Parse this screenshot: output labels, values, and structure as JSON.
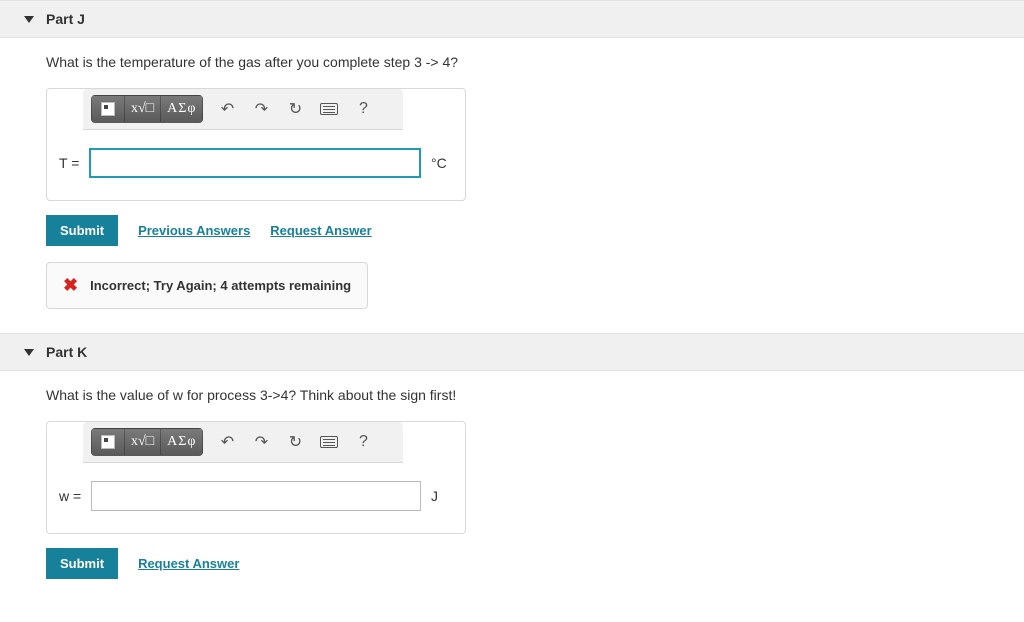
{
  "parts": [
    {
      "id": "J",
      "title": "Part J",
      "question": "What is the temperature of the gas after you complete step 3 -> 4?",
      "var_label": "T =",
      "unit": "°C",
      "input_focused": true,
      "toolbar": {
        "templates": "templates",
        "sqrt": "x√□",
        "greek": "ΑΣφ",
        "undo": "↶",
        "redo": "↷",
        "reset": "↻",
        "keyboard": "keyboard",
        "help": "?"
      },
      "actions": {
        "submit": "Submit",
        "previous": "Previous Answers",
        "request": "Request Answer"
      },
      "feedback": {
        "icon": "✖",
        "text": "Incorrect; Try Again; 4 attempts remaining"
      }
    },
    {
      "id": "K",
      "title": "Part K",
      "question": "What is the value of w for process 3->4? Think about the sign first!",
      "var_label": "w =",
      "unit": "J",
      "input_focused": false,
      "toolbar": {
        "templates": "templates",
        "sqrt": "x√□",
        "greek": "ΑΣφ",
        "undo": "↶",
        "redo": "↷",
        "reset": "↻",
        "keyboard": "keyboard",
        "help": "?"
      },
      "actions": {
        "submit": "Submit",
        "request": "Request Answer"
      }
    }
  ]
}
